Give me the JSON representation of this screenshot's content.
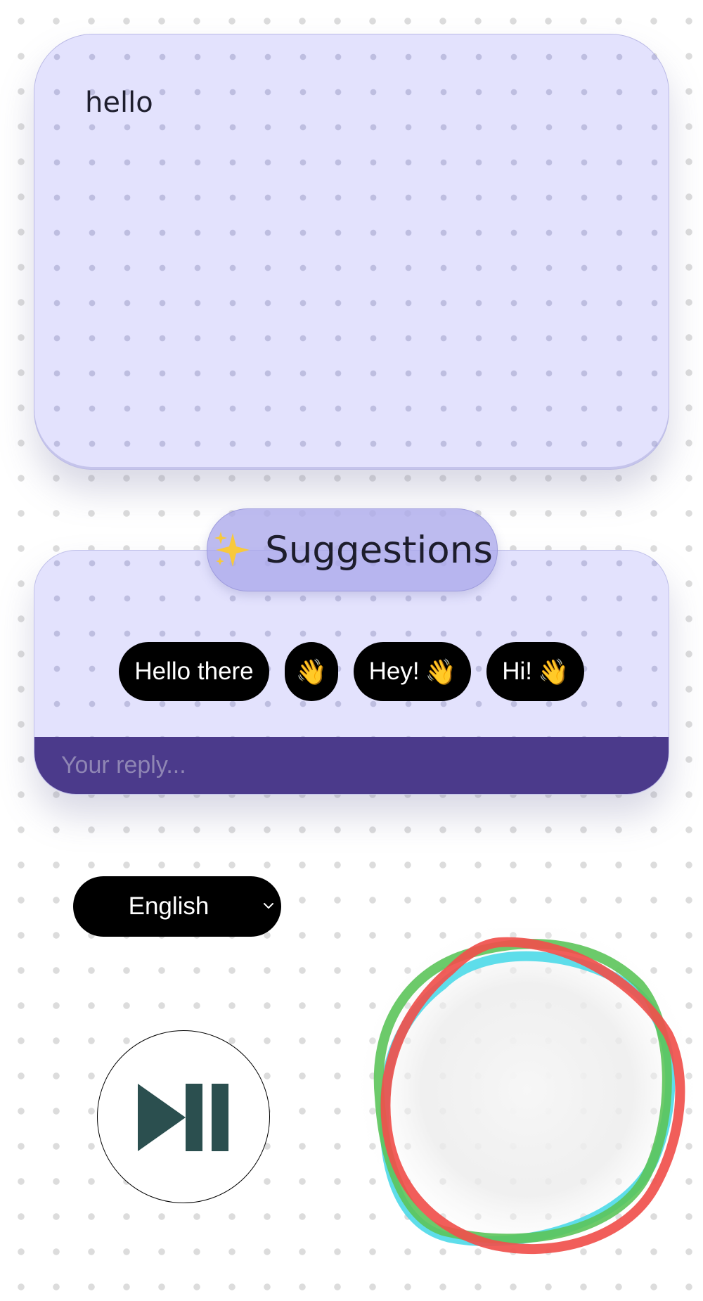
{
  "message": {
    "text": "hello"
  },
  "suggestions": {
    "title": "Suggestions",
    "header_icon": "sparkles-icon",
    "chips": [
      {
        "text": "Hello there",
        "emoji": ""
      },
      {
        "text": "",
        "emoji": "👋"
      },
      {
        "text": "Hey!",
        "emoji": "👋"
      },
      {
        "text": "Hi!",
        "emoji": "👋"
      }
    ]
  },
  "reply": {
    "placeholder": "Your reply..."
  },
  "language": {
    "selected": "English",
    "icon": "chevron-down-icon"
  },
  "player": {
    "icon": "play-pause-icon",
    "icon_color": "#2b4f4f"
  },
  "visualizer": {
    "ring_colors": [
      "#4cd9e8",
      "#5cc45a",
      "#f0504c"
    ]
  },
  "colors": {
    "card_background": "#e3e2fd",
    "header_pill": "#aaa8eb",
    "reply_bar": "#4b3a8b",
    "chip_background": "#000000"
  }
}
